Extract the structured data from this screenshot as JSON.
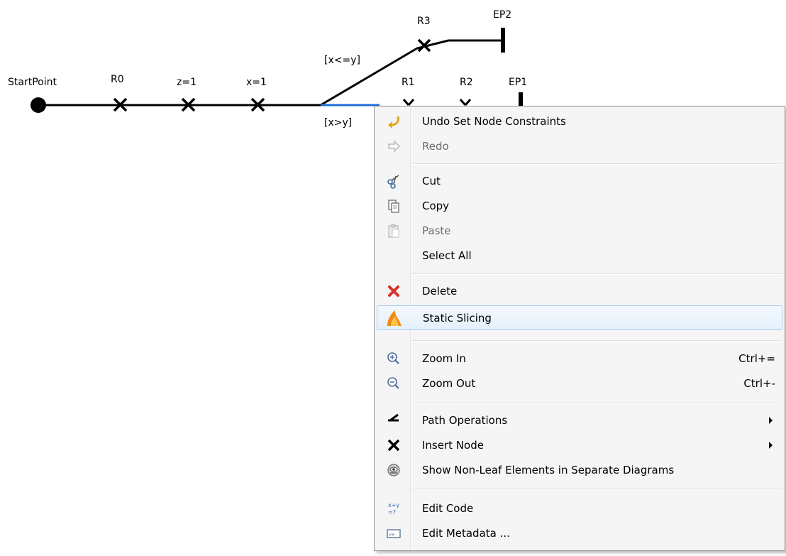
{
  "diagram": {
    "start_label": "StartPoint",
    "nodes": [
      "R0",
      "z=1",
      "x=1"
    ],
    "branch_upper_label": "[x<=y]",
    "branch_lower_label": "[x>y]",
    "upper_nodes": [
      "R3"
    ],
    "lower_nodes": [
      "R1",
      "R2"
    ],
    "end_upper": "EP2",
    "end_lower": "EP1",
    "colors": {
      "line": "#000000",
      "selected": "#1f6fd6"
    }
  },
  "menu": {
    "undo": "Undo Set Node Constraints",
    "redo": "Redo",
    "cut": "Cut",
    "copy": "Copy",
    "paste": "Paste",
    "select_all": "Select All",
    "delete": "Delete",
    "static_slicing": "Static Slicing",
    "zoom_in": "Zoom In",
    "zoom_in_shortcut": "Ctrl+=",
    "zoom_out": "Zoom Out",
    "zoom_out_shortcut": "Ctrl+-",
    "path_operations": "Path Operations",
    "insert_node": "Insert Node",
    "show_non_leaf": "Show Non-Leaf Elements in Separate Diagrams",
    "edit_code": "Edit Code",
    "edit_metadata": "Edit Metadata ...",
    "icons": [
      "undo-icon",
      "redo-icon",
      "cut-icon",
      "copy-icon",
      "paste-icon",
      "delete-icon",
      "slicing-icon",
      "zoom-in-icon",
      "zoom-out-icon",
      "path-operations-icon",
      "insert-node-icon",
      "diagrams-icon",
      "edit-code-icon",
      "edit-metadata-icon"
    ]
  }
}
